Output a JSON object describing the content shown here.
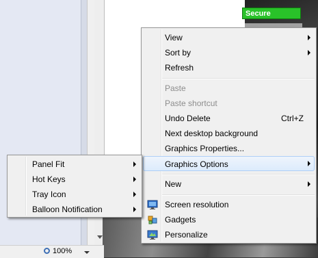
{
  "browser": {
    "secure_label": "Secure",
    "zoom_level": "100%"
  },
  "context_menu": {
    "items": [
      {
        "label": "View",
        "submenu": true,
        "disabled": false
      },
      {
        "label": "Sort by",
        "submenu": true,
        "disabled": false
      },
      {
        "label": "Refresh",
        "submenu": false,
        "disabled": false
      },
      {
        "label": "Paste",
        "submenu": false,
        "disabled": true
      },
      {
        "label": "Paste shortcut",
        "submenu": false,
        "disabled": true
      },
      {
        "label": "Undo Delete",
        "shortcut": "Ctrl+Z",
        "submenu": false,
        "disabled": false
      },
      {
        "label": "Next desktop background",
        "submenu": false,
        "disabled": false
      },
      {
        "label": "Graphics Properties...",
        "submenu": false,
        "disabled": false
      },
      {
        "label": "Graphics Options",
        "submenu": true,
        "disabled": false,
        "highlighted": true
      },
      {
        "label": "New",
        "submenu": true,
        "disabled": false
      },
      {
        "label": "Screen resolution",
        "icon": "monitor-icon"
      },
      {
        "label": "Gadgets",
        "icon": "gadgets-icon"
      },
      {
        "label": "Personalize",
        "icon": "personalize-icon"
      }
    ]
  },
  "graphics_submenu": {
    "items": [
      {
        "label": "Panel Fit",
        "submenu": true
      },
      {
        "label": "Hot Keys",
        "submenu": true
      },
      {
        "label": "Tray Icon",
        "submenu": true
      },
      {
        "label": "Balloon Notification",
        "submenu": true
      }
    ]
  },
  "colors": {
    "menu_bg": "#f0f0f0",
    "highlight": "#dcebfc",
    "secure_green": "#29c229"
  }
}
